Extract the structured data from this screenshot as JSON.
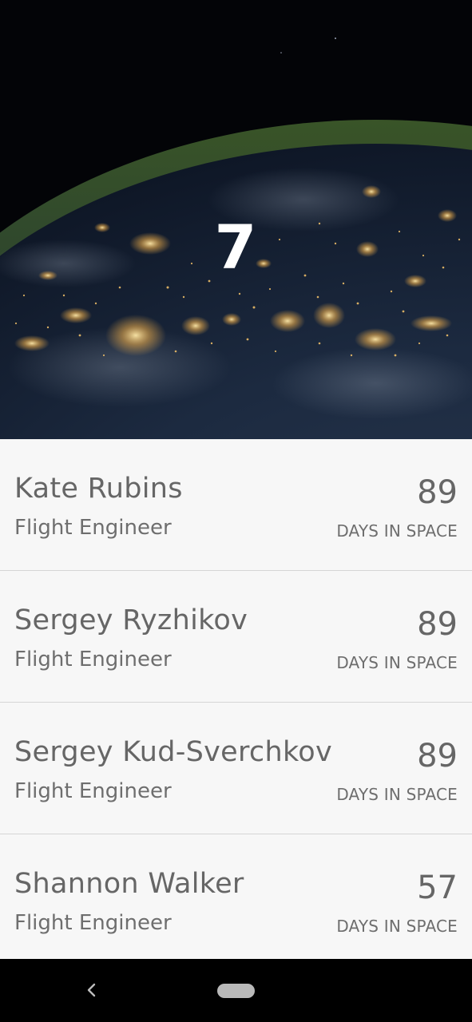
{
  "hero": {
    "people_in_space_count": "7",
    "background": "earth-at-night-image"
  },
  "crew": [
    {
      "name": "Kate Rubins",
      "role": "Flight Engineer",
      "days": "89",
      "days_label": "DAYS IN SPACE"
    },
    {
      "name": "Sergey Ryzhikov",
      "role": "Flight Engineer",
      "days": "89",
      "days_label": "DAYS IN SPACE"
    },
    {
      "name": "Sergey Kud-Sverchkov",
      "role": "Flight Engineer",
      "days": "89",
      "days_label": "DAYS IN SPACE"
    },
    {
      "name": "Shannon Walker",
      "role": "Flight Engineer",
      "days": "57",
      "days_label": "DAYS IN SPACE"
    }
  ],
  "navigation": {
    "back_icon": "chevron-left-icon",
    "home_icon": "home-pill-icon"
  },
  "colors": {
    "list_background": "#f7f7f7",
    "text_primary": "#666666",
    "divider": "#d6d6d6",
    "nav_background": "#000000"
  }
}
